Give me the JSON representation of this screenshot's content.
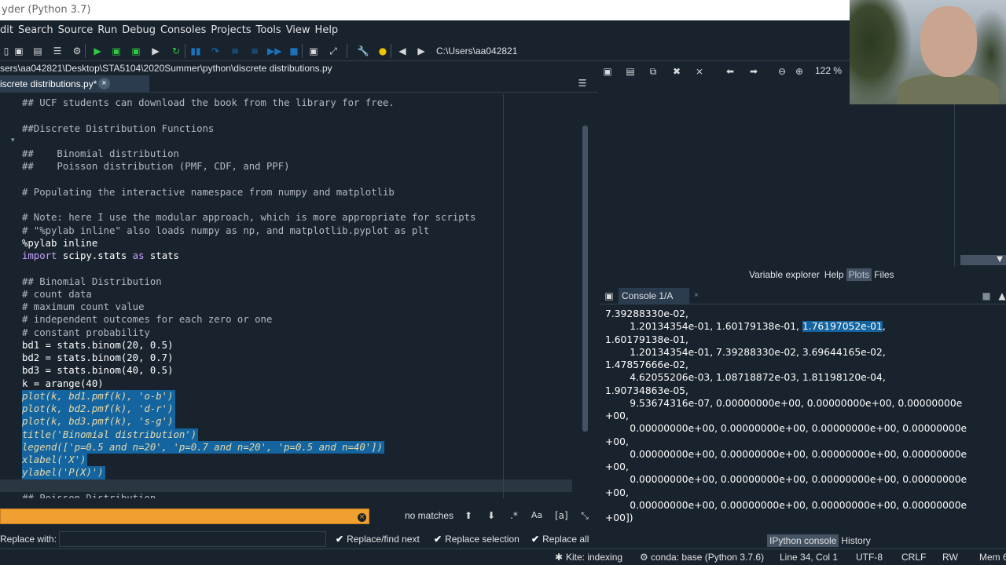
{
  "window": {
    "title": "yder (Python 3.7)"
  },
  "menu": [
    "dit",
    "Search",
    "Source",
    "Run",
    "Debug",
    "Consoles",
    "Projects",
    "Tools",
    "View",
    "Help"
  ],
  "toolbar": {
    "working_dir": "C:\\Users\\aa042821"
  },
  "editor": {
    "path": "sers\\aa042821\\Desktop\\STA5104\\2020Summer\\python\\discrete distributions.py",
    "tab_label": "iscrete distributions.py*",
    "lines": [
      {
        "text": "## UCF students can download the book from the library for free.",
        "kind": "comment"
      },
      {
        "text": "",
        "kind": "plain"
      },
      {
        "text": "##Discrete Distribution Functions",
        "kind": "comment"
      },
      {
        "text": "",
        "kind": "plain"
      },
      {
        "text": "##    Binomial distribution",
        "kind": "comment"
      },
      {
        "text": "##    Poisson distribution (PMF, CDF, and PPF)",
        "kind": "comment"
      },
      {
        "text": "",
        "kind": "plain"
      },
      {
        "text": "# Populating the interactive namespace from numpy and matplotlib",
        "kind": "comment"
      },
      {
        "text": "",
        "kind": "plain"
      },
      {
        "text": "# Note: here I use the modular approach, which is more appropriate for scripts",
        "kind": "comment"
      },
      {
        "text": "# \"%pylab inline\" also loads numpy as np, and matplotlib.pyplot as plt",
        "kind": "comment"
      },
      {
        "text": "%pylab inline",
        "kind": "plain"
      },
      {
        "text": "import scipy.stats as stats",
        "kind": "import"
      },
      {
        "text": "",
        "kind": "plain"
      },
      {
        "text": "## Binomial Distribution",
        "kind": "comment"
      },
      {
        "text": "# count data",
        "kind": "comment"
      },
      {
        "text": "# maximum count value",
        "kind": "comment"
      },
      {
        "text": "# independent outcomes for each zero or one",
        "kind": "comment"
      },
      {
        "text": "# constant probability",
        "kind": "comment"
      },
      {
        "text": "bd1 = stats.binom(20, 0.5)",
        "kind": "plain"
      },
      {
        "text": "bd2 = stats.binom(20, 0.7)",
        "kind": "plain"
      },
      {
        "text": "bd3 = stats.binom(40, 0.5)",
        "kind": "plain"
      },
      {
        "text": "k = arange(40)",
        "kind": "plain"
      },
      {
        "text": "plot(k, bd1.pmf(k), 'o-b')",
        "kind": "sel"
      },
      {
        "text": "plot(k, bd2.pmf(k), 'd-r')",
        "kind": "sel"
      },
      {
        "text": "plot(k, bd3.pmf(k), 's-g')",
        "kind": "sel"
      },
      {
        "text": "title('Binomial distribution')",
        "kind": "sel"
      },
      {
        "text": "legend(['p=0.5 and n=20', 'p=0.7 and n=20', 'p=0.5 and n=40'])",
        "kind": "sel"
      },
      {
        "text": "xlabel('X')",
        "kind": "sel"
      },
      {
        "text": "ylabel('P(X)')",
        "kind": "sel"
      },
      {
        "text": "",
        "kind": "plain"
      },
      {
        "text": "## Poisson Distribution",
        "kind": "comment"
      }
    ]
  },
  "findbar": {
    "status": "no matches"
  },
  "replacebar": {
    "label": "Replace with:",
    "btn_find_next": "Replace/find next",
    "btn_selection": "Replace selection",
    "btn_all": "Replace all"
  },
  "plots": {
    "zoom": "122 %"
  },
  "right_tabs": [
    "Variable explorer",
    "Help",
    "Plots",
    "Files"
  ],
  "console": {
    "tab_label": "Console 1/A",
    "lines": [
      "7.39288330e-02,",
      "        1.20134354e-01, 1.60179138e-01, |1.76197052e-01|,",
      "1.60179138e-01,",
      "        1.20134354e-01, 7.39288330e-02, 3.69644165e-02,",
      "1.47857666e-02,",
      "        4.62055206e-03, 1.08718872e-03, 1.81198120e-04,",
      "1.90734863e-05,",
      "        9.53674316e-07, 0.00000000e+00, 0.00000000e+00, 0.00000000e",
      "+00,",
      "        0.00000000e+00, 0.00000000e+00, 0.00000000e+00, 0.00000000e",
      "+00,",
      "        0.00000000e+00, 0.00000000e+00, 0.00000000e+00, 0.00000000e",
      "+00,",
      "        0.00000000e+00, 0.00000000e+00, 0.00000000e+00, 0.00000000e",
      "+00,",
      "        0.00000000e+00, 0.00000000e+00, 0.00000000e+00, 0.00000000e",
      "+00])"
    ]
  },
  "bottom_tabs": [
    "IPython console",
    "History"
  ],
  "status": {
    "kite": "Kite: indexing",
    "conda": "conda: base (Python 3.7.6)",
    "cursor": "Line 34, Col 1",
    "encoding": "UTF-8",
    "eol": "CRLF",
    "rw": "RW",
    "mem": "Mem 6"
  }
}
